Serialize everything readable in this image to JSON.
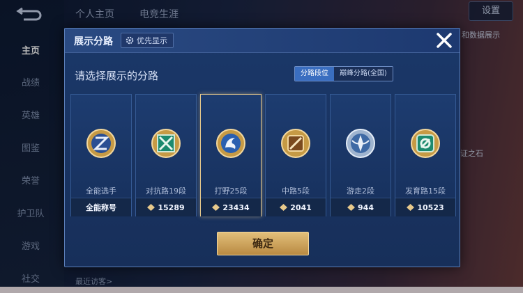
{
  "background": {
    "sidebar": [
      "主页",
      "战绩",
      "英雄",
      "图鉴",
      "荣誉",
      "护卫队",
      "游戏",
      "社交"
    ],
    "top_tabs": [
      "个人主页",
      "电竞生涯"
    ],
    "settings_label": "设置",
    "right_texts": [
      "和数据展示",
      "证之石"
    ],
    "bottom_text": "最近访客>"
  },
  "modal": {
    "title": "展示分路",
    "priority_label": "优先显示",
    "subtitle": "请选择展示的分路",
    "segments": [
      "分路段位",
      "巅峰分路(全国)"
    ],
    "active_segment": 0,
    "cards": [
      {
        "name": "全能选手",
        "value": "全能称号",
        "show_points": false,
        "icon": "all-round-emblem-icon"
      },
      {
        "name": "对抗路19段",
        "value": "15289",
        "show_points": true,
        "icon": "clash-lane-emblem-icon"
      },
      {
        "name": "打野25段",
        "value": "23434",
        "show_points": true,
        "icon": "jungle-emblem-icon",
        "selected": true
      },
      {
        "name": "中路5段",
        "value": "2041",
        "show_points": true,
        "icon": "mid-lane-emblem-icon"
      },
      {
        "name": "游走2段",
        "value": "944",
        "show_points": true,
        "icon": "roam-emblem-icon"
      },
      {
        "name": "发育路15段",
        "value": "10523",
        "show_points": true,
        "icon": "farm-lane-emblem-icon"
      }
    ],
    "confirm_label": "确定"
  },
  "colors": {
    "gold": "#e7c98c",
    "accent": "#3a6ec0",
    "bg": "#172f5a"
  }
}
